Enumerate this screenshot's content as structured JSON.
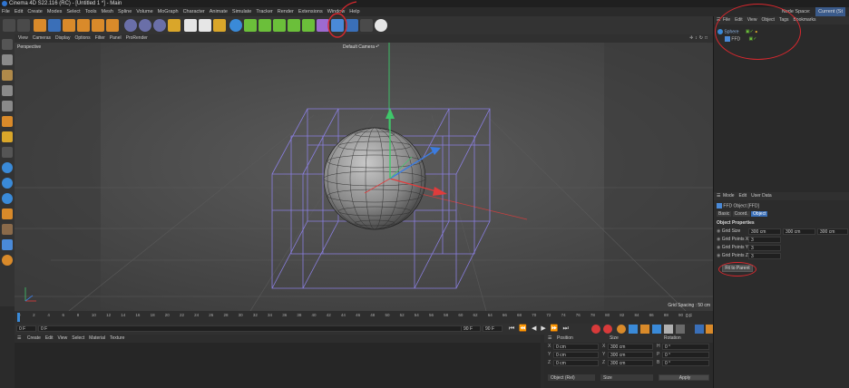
{
  "window": {
    "title": "Cinema 4D S22.116 (RC) - [Untitled 1 *] - Main"
  },
  "menubar": {
    "items": [
      "File",
      "Edit",
      "Create",
      "Modes",
      "Select",
      "Tools",
      "Mesh",
      "Spline",
      "Volume",
      "MoGraph",
      "Character",
      "Animate",
      "Simulate",
      "Tracker",
      "Render",
      "Extensions",
      "Window",
      "Help"
    ],
    "node_space_label": "Node Space:",
    "node_space_value": "Current (St"
  },
  "viewport": {
    "menu": [
      "View",
      "Cameras",
      "Display",
      "Options",
      "Filter",
      "Panel",
      "ProRender"
    ],
    "projection": "Perspective",
    "camera": "Default Camera •°",
    "grid_spacing": "Grid Spacing : 50 cm"
  },
  "timeline": {
    "ticks": [
      "0",
      "2",
      "4",
      "6",
      "8",
      "10",
      "12",
      "14",
      "16",
      "18",
      "20",
      "22",
      "24",
      "26",
      "28",
      "30",
      "32",
      "34",
      "36",
      "38",
      "40",
      "42",
      "44",
      "46",
      "48",
      "50",
      "52",
      "54",
      "56",
      "58",
      "60",
      "62",
      "64",
      "66",
      "68",
      "70",
      "72",
      "74",
      "76",
      "78",
      "80",
      "82",
      "84",
      "86",
      "88",
      "90"
    ],
    "current_frame": "0 F"
  },
  "transport": {
    "start": "0 F",
    "min": "0 F",
    "max": "90 F",
    "end": "90 F"
  },
  "material_manager": {
    "menu": [
      "Create",
      "Edit",
      "View",
      "Select",
      "Material",
      "Texture"
    ]
  },
  "object_manager": {
    "menu": [
      "File",
      "Edit",
      "View",
      "Object",
      "Tags",
      "Bookmarks"
    ],
    "objects": [
      {
        "name": "Sphere",
        "indent": 0
      },
      {
        "name": "FFD",
        "indent": 1
      }
    ]
  },
  "attribute_manager": {
    "menu": [
      "Mode",
      "Edit",
      "User Data"
    ],
    "object_title": "FFD Object [FFD]",
    "tabs": [
      "Basic",
      "Coord.",
      "Object"
    ],
    "active_tab": "Object",
    "section": "Object Properties",
    "grid_size_label": "Grid Size",
    "grid_size": [
      "300 cm",
      "300 cm",
      "300 cm"
    ],
    "grid_points_x_label": "Grid Points X",
    "grid_points_x": "3",
    "grid_points_y_label": "Grid Points Y",
    "grid_points_y": "3",
    "grid_points_z_label": "Grid Points Z",
    "grid_points_z": "3",
    "fit_button": "Fit to Parent"
  },
  "coordinates": {
    "headers": [
      "Position",
      "Size",
      "Rotation"
    ],
    "rows": [
      {
        "axis": "X",
        "pos": "0 cm",
        "size_axis": "X",
        "size": "300 cm",
        "rot_axis": "H",
        "rot": "0 °"
      },
      {
        "axis": "Y",
        "pos": "0 cm",
        "size_axis": "Y",
        "size": "300 cm",
        "rot_axis": "P",
        "rot": "0 °"
      },
      {
        "axis": "Z",
        "pos": "0 cm",
        "size_axis": "Z",
        "size": "300 cm",
        "rot_axis": "B",
        "rot": "0 °"
      }
    ],
    "mode": "Object (Rel)",
    "size_mode": "Size",
    "apply": "Apply"
  },
  "colors": {
    "annotation": "#d8282e",
    "ffd_lattice": "#8a7fe0",
    "accent_blue": "#3a6fb8",
    "axis_red": "#e03c3c",
    "axis_green": "#3fc86a",
    "axis_blue": "#3c7ce0"
  }
}
